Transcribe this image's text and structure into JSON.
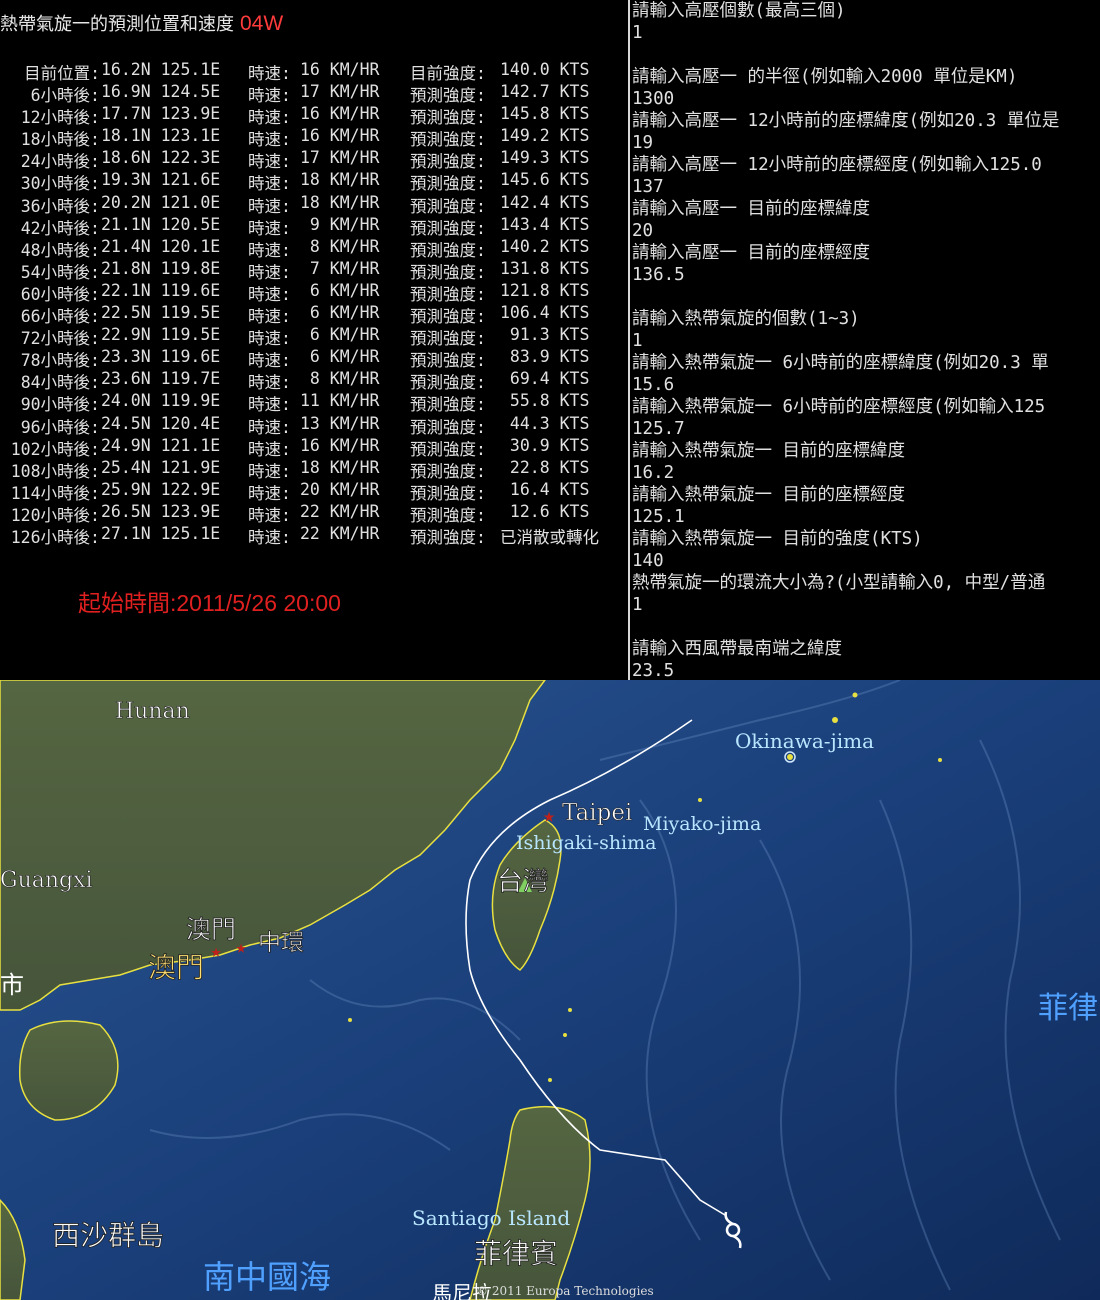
{
  "title": {
    "text": "熱帶氣旋一的預測位置和速度",
    "code": "04W"
  },
  "forecast_rows": [
    {
      "label": "目前位置:",
      "pos": "16.2N 125.1E",
      "speed_label": "時速:",
      "speed": "16 KM/HR",
      "int_label": "目前強度:",
      "intensity": "140.0 KTS"
    },
    {
      "label": "6小時後:",
      "pos": "16.9N 124.5E",
      "speed_label": "時速:",
      "speed": "17 KM/HR",
      "int_label": "預測強度:",
      "intensity": "142.7 KTS"
    },
    {
      "label": "12小時後:",
      "pos": "17.7N 123.9E",
      "speed_label": "時速:",
      "speed": "16 KM/HR",
      "int_label": "預測強度:",
      "intensity": "145.8 KTS"
    },
    {
      "label": "18小時後:",
      "pos": "18.1N 123.1E",
      "speed_label": "時速:",
      "speed": "16 KM/HR",
      "int_label": "預測強度:",
      "intensity": "149.2 KTS"
    },
    {
      "label": "24小時後:",
      "pos": "18.6N 122.3E",
      "speed_label": "時速:",
      "speed": "17 KM/HR",
      "int_label": "預測強度:",
      "intensity": "149.3 KTS"
    },
    {
      "label": "30小時後:",
      "pos": "19.3N 121.6E",
      "speed_label": "時速:",
      "speed": "18 KM/HR",
      "int_label": "預測強度:",
      "intensity": "145.6 KTS"
    },
    {
      "label": "36小時後:",
      "pos": "20.2N 121.0E",
      "speed_label": "時速:",
      "speed": "18 KM/HR",
      "int_label": "預測強度:",
      "intensity": "142.4 KTS"
    },
    {
      "label": "42小時後:",
      "pos": "21.1N 120.5E",
      "speed_label": "時速:",
      "speed": " 9 KM/HR",
      "int_label": "預測強度:",
      "intensity": "143.4 KTS"
    },
    {
      "label": "48小時後:",
      "pos": "21.4N 120.1E",
      "speed_label": "時速:",
      "speed": " 8 KM/HR",
      "int_label": "預測強度:",
      "intensity": "140.2 KTS"
    },
    {
      "label": "54小時後:",
      "pos": "21.8N 119.8E",
      "speed_label": "時速:",
      "speed": " 7 KM/HR",
      "int_label": "預測強度:",
      "intensity": "131.8 KTS"
    },
    {
      "label": "60小時後:",
      "pos": "22.1N 119.6E",
      "speed_label": "時速:",
      "speed": " 6 KM/HR",
      "int_label": "預測強度:",
      "intensity": "121.8 KTS"
    },
    {
      "label": "66小時後:",
      "pos": "22.5N 119.5E",
      "speed_label": "時速:",
      "speed": " 6 KM/HR",
      "int_label": "預測強度:",
      "intensity": "106.4 KTS"
    },
    {
      "label": "72小時後:",
      "pos": "22.9N 119.5E",
      "speed_label": "時速:",
      "speed": " 6 KM/HR",
      "int_label": "預測強度:",
      "intensity": " 91.3 KTS"
    },
    {
      "label": "78小時後:",
      "pos": "23.3N 119.6E",
      "speed_label": "時速:",
      "speed": " 6 KM/HR",
      "int_label": "預測強度:",
      "intensity": " 83.9 KTS"
    },
    {
      "label": "84小時後:",
      "pos": "23.6N 119.7E",
      "speed_label": "時速:",
      "speed": " 8 KM/HR",
      "int_label": "預測強度:",
      "intensity": " 69.4 KTS"
    },
    {
      "label": "90小時後:",
      "pos": "24.0N 119.9E",
      "speed_label": "時速:",
      "speed": "11 KM/HR",
      "int_label": "預測強度:",
      "intensity": " 55.8 KTS"
    },
    {
      "label": "96小時後:",
      "pos": "24.5N 120.4E",
      "speed_label": "時速:",
      "speed": "13 KM/HR",
      "int_label": "預測強度:",
      "intensity": " 44.3 KTS"
    },
    {
      "label": "102小時後:",
      "pos": "24.9N 121.1E",
      "speed_label": "時速:",
      "speed": "16 KM/HR",
      "int_label": "預測強度:",
      "intensity": " 30.9 KTS"
    },
    {
      "label": "108小時後:",
      "pos": "25.4N 121.9E",
      "speed_label": "時速:",
      "speed": "18 KM/HR",
      "int_label": "預測強度:",
      "intensity": " 22.8 KTS"
    },
    {
      "label": "114小時後:",
      "pos": "25.9N 122.9E",
      "speed_label": "時速:",
      "speed": "20 KM/HR",
      "int_label": "預測強度:",
      "intensity": " 16.4 KTS"
    },
    {
      "label": "120小時後:",
      "pos": "26.5N 123.9E",
      "speed_label": "時速:",
      "speed": "22 KM/HR",
      "int_label": "預測強度:",
      "intensity": " 12.6 KTS"
    },
    {
      "label": "126小時後:",
      "pos": "27.1N 125.1E",
      "speed_label": "時速:",
      "speed": "22 KM/HR",
      "int_label": "預測強度:",
      "intensity": "已消散或轉化"
    }
  ],
  "start_time": "起始時間:2011/5/26 20:00",
  "console_lines": [
    "請輸入高壓個數(最高三個)",
    "1",
    "",
    "請輸入高壓一 的半徑(例如輸入2000 單位是KM)",
    "1300",
    "請輸入高壓一 12小時前的座標緯度(例如20.3 單位是",
    "19",
    "請輸入高壓一 12小時前的座標經度(例如輸入125.0",
    "137",
    "請輸入高壓一 目前的座標緯度",
    "20",
    "請輸入高壓一 目前的座標經度",
    "136.5",
    "",
    "請輸入熱帶氣旋的個數(1~3)",
    "1",
    "請輸入熱帶氣旋一 6小時前的座標緯度(例如20.3 單",
    "15.6",
    "請輸入熱帶氣旋一 6小時前的座標經度(例如輸入125",
    "125.7",
    "請輸入熱帶氣旋一 目前的座標緯度",
    "16.2",
    "請輸入熱帶氣旋一 目前的座標經度",
    "125.1",
    "請輸入熱帶氣旋一 目前的強度(KTS)",
    "140",
    "熱帶氣旋一的環流大小為?(小型請輸入0, 中型/普通",
    "1",
    "",
    "請輸入西風帶最南端之緯度",
    "23.5"
  ],
  "map": {
    "labels": {
      "hunan": "Hunan",
      "guangxi": "Guangxi",
      "okinawa": "Okinawa-jima",
      "taipei": "Taipei",
      "miyako": "Miyako-jima",
      "ishigaki": "Ishigaki-shima",
      "taiwan": "台灣",
      "macau_star": "澳門",
      "central": "中環",
      "macau": "澳門",
      "city_edge": "市",
      "paracel": "西沙群島",
      "santiago": "Santiago Island",
      "philippines": "菲律賓",
      "philippines_edge": "菲律",
      "scs": "南中國海",
      "copyright": "© 2011 Europa Technologies",
      "manila_partial": "馬尼拉"
    },
    "colors": {
      "ocean": "#1a3f7a",
      "land": "#4a5a35",
      "coast": "#e8e040",
      "track": "#ffffff"
    }
  }
}
